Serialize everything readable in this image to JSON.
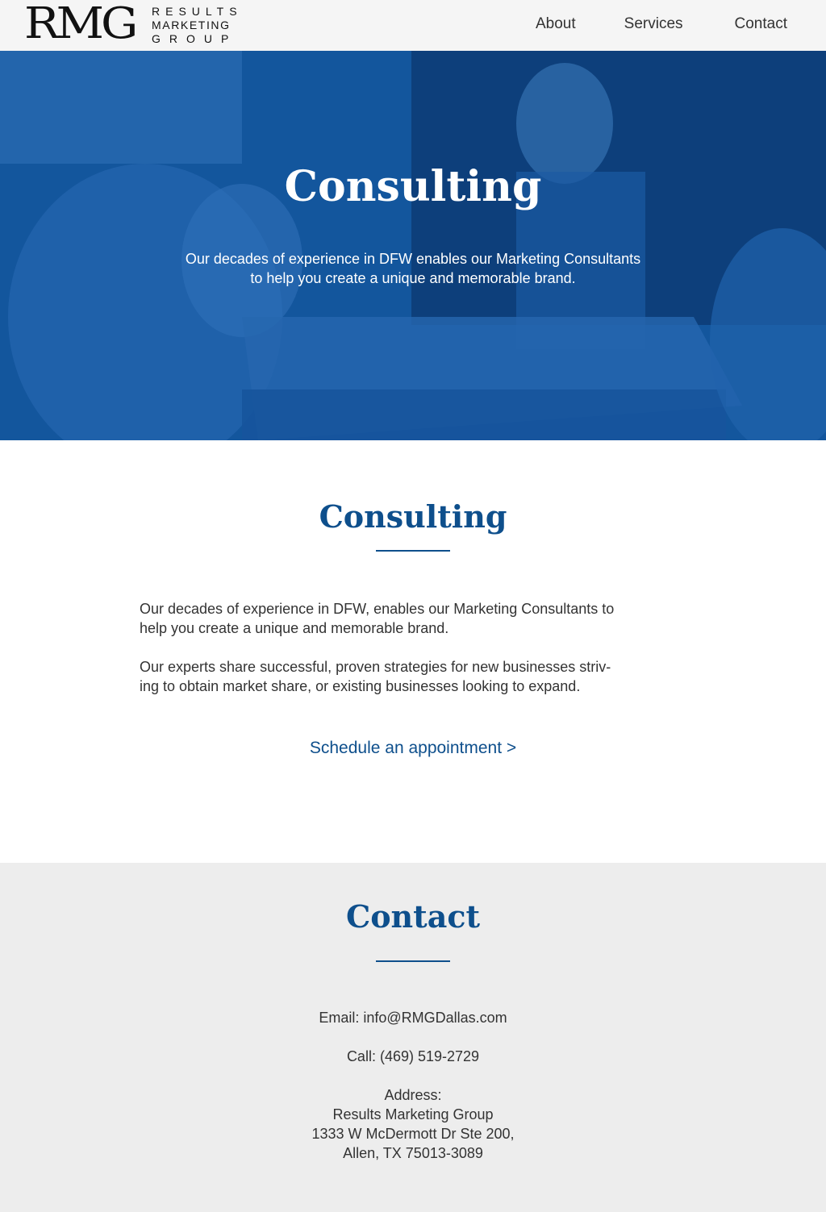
{
  "header": {
    "logo_mark": "RMG",
    "logo_line1": "RESULTS",
    "logo_line2": "MARKETING",
    "logo_line3": "GROUP",
    "nav": [
      "About",
      "Services",
      "Contact"
    ]
  },
  "hero": {
    "title": "Consulting",
    "subtitle_line1": "Our decades of experience in DFW enables our Marketing Consultants",
    "subtitle_line2": "to help you create a unique and memorable brand.",
    "bg_color": "#0e4f98"
  },
  "main": {
    "title": "Consulting",
    "para1_line1": "Our decades of experience in DFW, enables our Marketing Consultants to",
    "para1_line2": "help you create a unique and memorable brand.",
    "para2_line1": "Our experts share successful, proven strategies for new businesses striv-",
    "para2_line2": "ing to obtain market share, or existing businesses looking to expand.",
    "cta": "Schedule an appointment >"
  },
  "contact": {
    "title": "Contact",
    "email": "Email: info@RMGDallas.com",
    "call": "Call: (469) 519-2729",
    "address_label": "Address:",
    "address_line1": "Results Marketing Group",
    "address_line2": "1333 W McDermott Dr Ste 200,",
    "address_line3": "Allen, TX 75013-3089"
  },
  "colors": {
    "accent": "#0e4f8c",
    "header_bg": "#f5f5f5",
    "contact_bg": "#ededed"
  }
}
